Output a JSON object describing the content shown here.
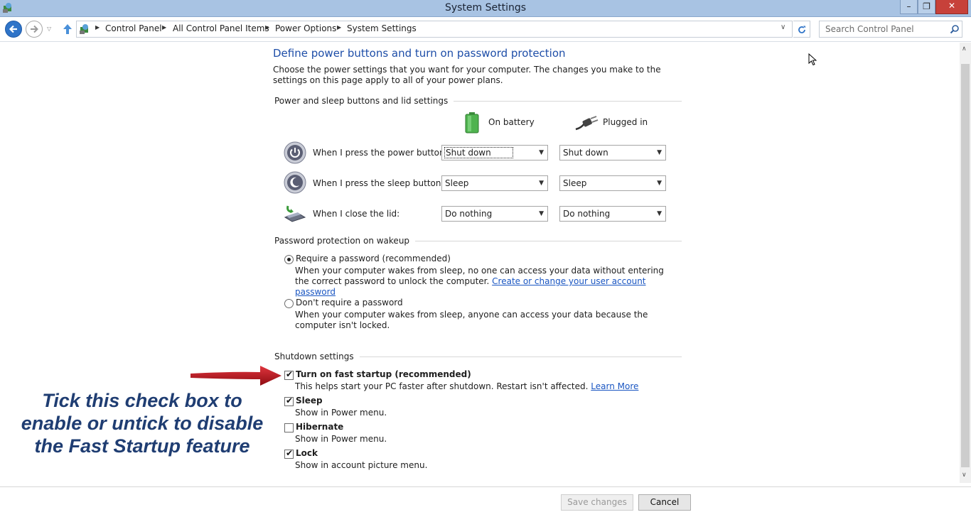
{
  "window": {
    "title": "System Settings"
  },
  "address_bar": {
    "crumbs": [
      "Control Panel",
      "All Control Panel Items",
      "Power Options",
      "System Settings"
    ]
  },
  "search": {
    "placeholder": "Search Control Panel"
  },
  "page": {
    "heading": "Define power buttons and turn on password protection",
    "intro": "Choose the power settings that you want for your computer. The changes you make to the settings on this page apply to all of your power plans."
  },
  "buttons_section": {
    "title": "Power and sleep buttons and lid settings",
    "col_battery": "On battery",
    "col_plugged": "Plugged in",
    "rows": [
      {
        "label": "When I press the power button:",
        "battery": "Shut down",
        "plugged": "Shut down"
      },
      {
        "label": "When I press the sleep button:",
        "battery": "Sleep",
        "plugged": "Sleep"
      },
      {
        "label": "When I close the lid:",
        "battery": "Do nothing",
        "plugged": "Do nothing"
      }
    ]
  },
  "password_section": {
    "title": "Password protection on wakeup",
    "require_label": "Require a password (recommended)",
    "require_desc": "When your computer wakes from sleep, no one can access your data without entering the correct password to unlock the computer.",
    "require_link": "Create or change your user account password",
    "norequire_label": "Don't require a password",
    "norequire_desc": "When your computer wakes from sleep, anyone can access your data because the computer isn't locked.",
    "selected": "require"
  },
  "shutdown_section": {
    "title": "Shutdown settings",
    "items": [
      {
        "label": "Turn on fast startup (recommended)",
        "desc": "This helps start your PC faster after shutdown. Restart isn't affected.",
        "link": "Learn More",
        "checked": true
      },
      {
        "label": "Sleep",
        "desc": "Show in Power menu.",
        "checked": true
      },
      {
        "label": "Hibernate",
        "desc": "Show in Power menu.",
        "checked": false
      },
      {
        "label": "Lock",
        "desc": "Show in account picture menu.",
        "checked": true
      }
    ]
  },
  "annotation": {
    "lines": [
      "Tick this check box to",
      "enable or untick to disable",
      "the Fast Startup feature"
    ],
    "color": "#1f3d72",
    "arrow_color": "#b3121b"
  },
  "footer": {
    "save_label": "Save changes",
    "cancel_label": "Cancel"
  }
}
